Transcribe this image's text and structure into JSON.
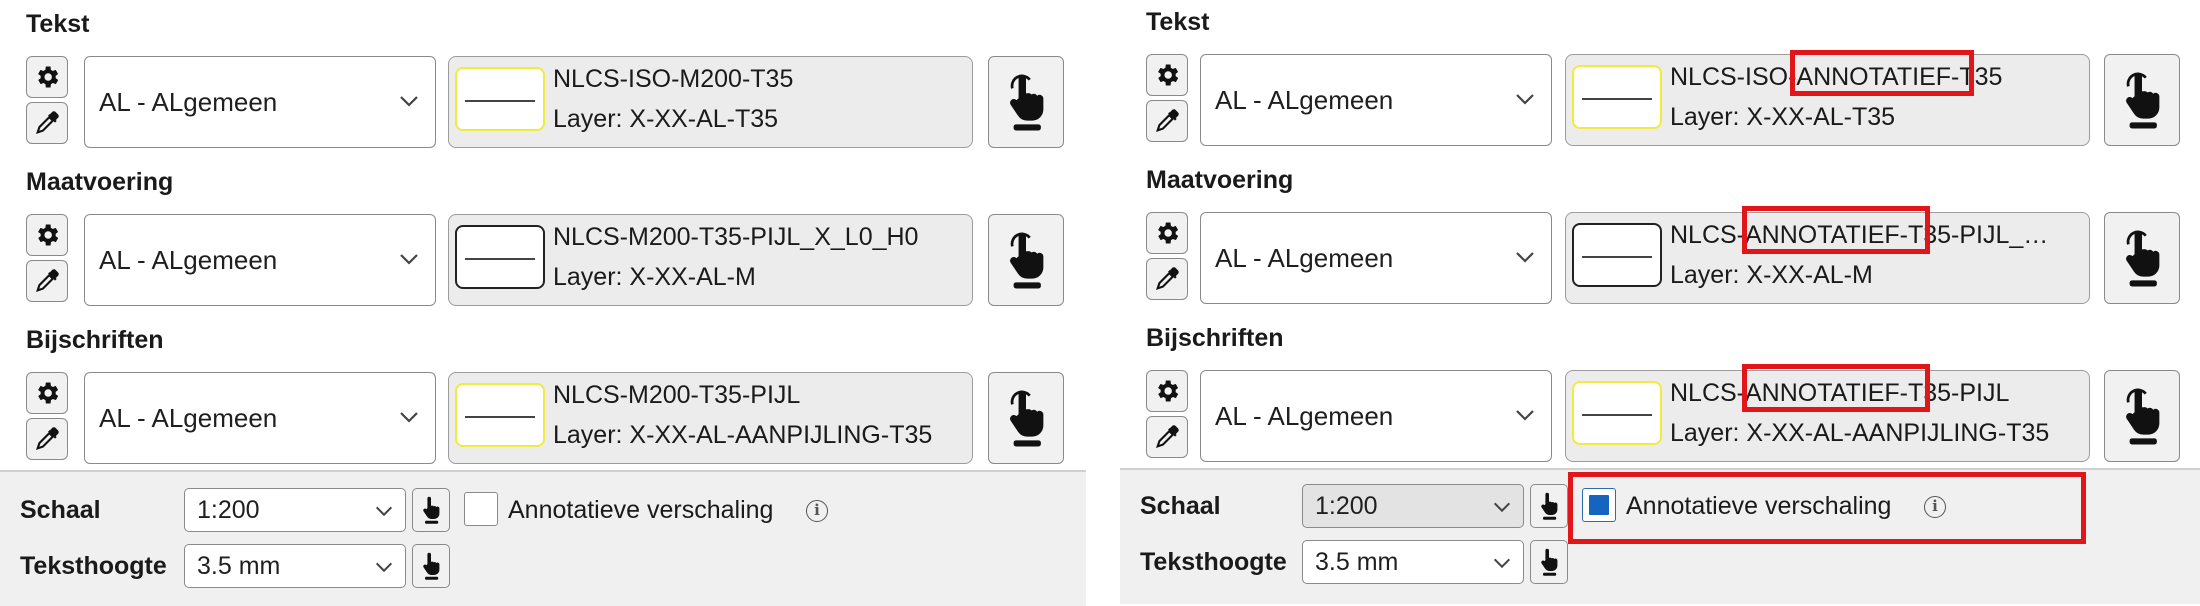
{
  "left": {
    "sections": [
      {
        "title": "Tekst",
        "select": "AL - ALgemeen",
        "style_name": "NLCS-ISO-M200-T35",
        "layer": "Layer: X-XX-AL-T35",
        "preview": "yellow"
      },
      {
        "title": "Maatvoering",
        "select": "AL - ALgemeen",
        "style_name": "NLCS-M200-T35-PIJL_X_L0_H0",
        "layer": "Layer: X-XX-AL-M",
        "preview": "black"
      },
      {
        "title": "Bijschriften",
        "select": "AL - ALgemeen",
        "style_name": "NLCS-M200-T35-PIJL",
        "layer": "Layer: X-XX-AL-AANPIJLING-T35",
        "preview": "yellow"
      }
    ],
    "footer": {
      "schaal_label": "Schaal",
      "schaal_value": "1:200",
      "teksthoogte_label": "Teksthoogte",
      "teksthoogte_value": "3.5 mm",
      "checkbox_label": "Annotatieve verschaling",
      "checked": false
    }
  },
  "right": {
    "sections": [
      {
        "title": "Tekst",
        "select": "AL - ALgemeen",
        "style_name": "NLCS-ISO-ANNOTATIEF-T35",
        "layer": "Layer: X-XX-AL-T35",
        "preview": "yellow"
      },
      {
        "title": "Maatvoering",
        "select": "AL - ALgemeen",
        "style_name": "NLCS-ANNOTATIEF-T35-PIJL_…",
        "layer": "Layer: X-XX-AL-M",
        "preview": "black"
      },
      {
        "title": "Bijschriften",
        "select": "AL - ALgemeen",
        "style_name": "NLCS-ANNOTATIEF-T35-PIJL",
        "layer": "Layer: X-XX-AL-AANPIJLING-T35",
        "preview": "yellow"
      }
    ],
    "footer": {
      "schaal_label": "Schaal",
      "schaal_value": "1:200",
      "teksthoogte_label": "Teksthoogte",
      "teksthoogte_value": "3.5 mm",
      "checkbox_label": "Annotatieve verschaling",
      "checked": true
    }
  },
  "icons": {
    "settings": "gear-icon",
    "eyedropper": "eyedropper-icon",
    "pick": "hand-pointer-icon",
    "dropdown": "chevron-down-icon",
    "info": "info-icon"
  },
  "info_glyph": "i",
  "colors": {
    "highlight": "#e0161b",
    "checkbox_fill": "#1565c0",
    "preview_yellow": "#f1ea3f",
    "panel_bg": "#ececec",
    "footer_bg": "#f0f0f0"
  }
}
